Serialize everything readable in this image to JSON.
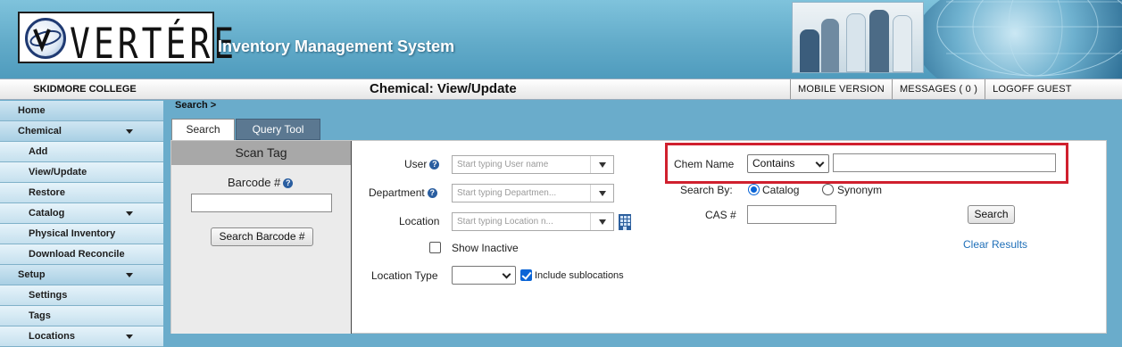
{
  "header": {
    "logo_text": "VERTÉRE",
    "app_title": "Inventory Management System"
  },
  "topbar": {
    "college": "SKIDMORE COLLEGE",
    "page_title": "Chemical: View/Update",
    "links": [
      "MOBILE VERSION",
      "MESSAGES ( 0 )",
      "LOGOFF GUEST"
    ]
  },
  "sidebar": {
    "items": [
      {
        "label": "Home",
        "level": "top",
        "expandable": false
      },
      {
        "label": "Chemical",
        "level": "top",
        "expandable": true
      },
      {
        "label": "Add",
        "level": "sub",
        "expandable": false
      },
      {
        "label": "View/Update",
        "level": "sub",
        "expandable": false
      },
      {
        "label": "Restore",
        "level": "sub",
        "expandable": false
      },
      {
        "label": "Catalog",
        "level": "sub",
        "expandable": true
      },
      {
        "label": "Physical Inventory",
        "level": "sub",
        "expandable": false
      },
      {
        "label": "Download Reconcile",
        "level": "sub",
        "expandable": false
      },
      {
        "label": "Setup",
        "level": "top",
        "expandable": true
      },
      {
        "label": "Settings",
        "level": "sub",
        "expandable": false
      },
      {
        "label": "Tags",
        "level": "sub",
        "expandable": false
      },
      {
        "label": "Locations",
        "level": "sub",
        "expandable": true
      }
    ]
  },
  "breadcrumb": "Search >",
  "tabs": {
    "search": "Search",
    "query": "Query Tool"
  },
  "scan_tag": {
    "title": "Scan Tag",
    "barcode_label": "Barcode #",
    "barcode_value": "",
    "button": "Search Barcode #"
  },
  "filters": {
    "user_label": "User",
    "user_placeholder": "Start typing User name",
    "department_label": "Department",
    "department_placeholder": "Start typing Departmen...",
    "location_label": "Location",
    "location_placeholder": "Start typing Location n...",
    "show_inactive_label": "Show Inactive",
    "show_inactive_checked": false,
    "location_type_label": "Location Type",
    "location_type_value": "",
    "include_sublocations_label": "Include sublocations",
    "include_sublocations_checked": true
  },
  "chem_search": {
    "chem_name_label": "Chem Name",
    "match_mode": "Contains",
    "chem_name_value": "",
    "search_by_label": "Search By:",
    "options": [
      "Catalog",
      "Synonym"
    ],
    "selected": "Catalog",
    "cas_label": "CAS #",
    "cas_value": "",
    "search_button": "Search",
    "clear_link": "Clear Results"
  },
  "colors": {
    "banner": "#62abc9",
    "sidebar": "#c5e0ee",
    "highlight": "#d0202e",
    "link": "#1f6fb8",
    "tab_inactive": "#5b7891"
  }
}
